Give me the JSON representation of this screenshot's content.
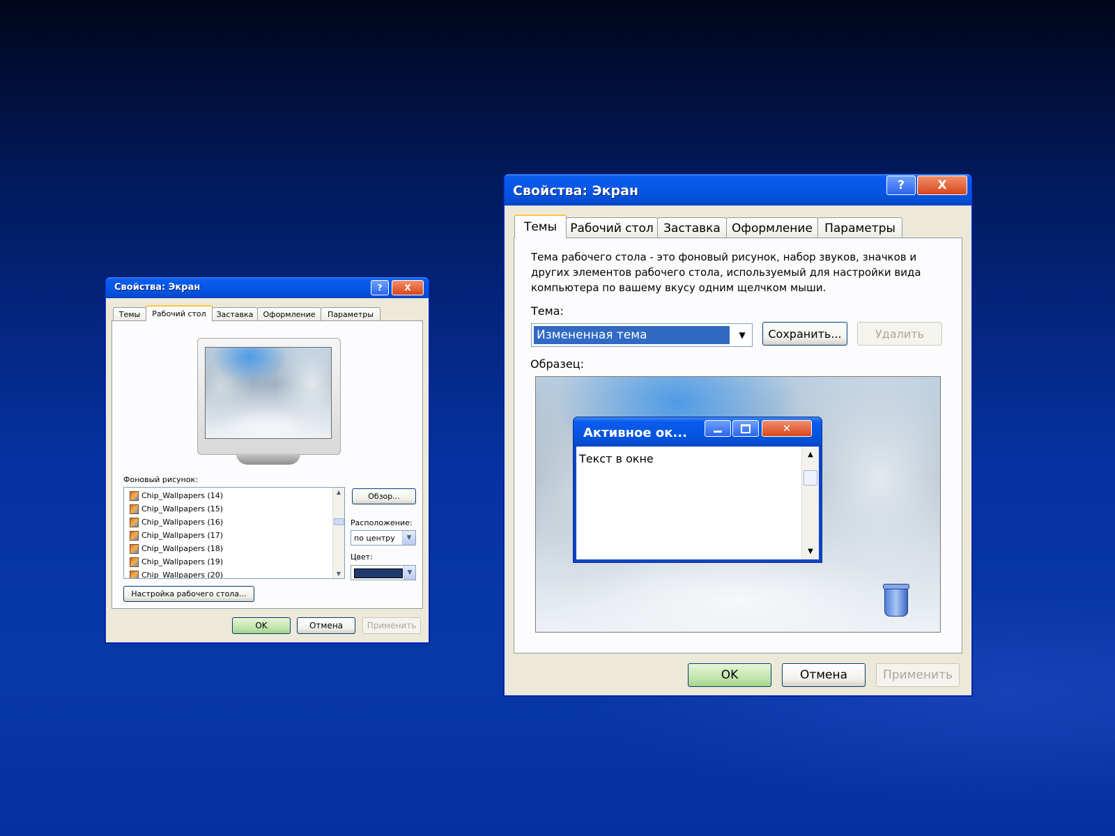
{
  "small_window": {
    "title": "Свойства: Экран",
    "help_label": "?",
    "close_label": "X",
    "tabs": [
      "Темы",
      "Рабочий стол",
      "Заставка",
      "Оформление",
      "Параметры"
    ],
    "active_tab": "Рабочий стол",
    "background_label": "Фоновый рисунок:",
    "wallpapers": [
      "Chip_Wallpapers (14)",
      "Chip_Wallpapers (15)",
      "Chip_Wallpapers (16)",
      "Chip_Wallpapers (17)",
      "Chip_Wallpapers (18)",
      "Chip_Wallpapers (19)",
      "Chip_Wallpapers (20)"
    ],
    "browse_label": "Обзор...",
    "position_label": "Расположение:",
    "position_value": "по центру",
    "color_label": "Цвет:",
    "color_value": "#1f3a6e",
    "customize_label": "Настройка рабочего стола...",
    "ok_label": "OK",
    "cancel_label": "Отмена",
    "apply_label": "Применить"
  },
  "large_window": {
    "title": "Свойства: Экран",
    "help_label": "?",
    "close_label": "X",
    "tabs": [
      "Темы",
      "Рабочий стол",
      "Заставка",
      "Оформление",
      "Параметры"
    ],
    "active_tab": "Темы",
    "description": "Тема рабочего стола - это фоновый рисунок, набор звуков, значков и других элементов рабочего стола, используемый для настройки вида компьютера по вашему вкусу одним щелчком мыши.",
    "theme_label": "Тема:",
    "theme_value": "Измененная тема",
    "save_label": "Сохранить...",
    "delete_label": "Удалить",
    "sample_label": "Образец:",
    "preview_window_title": "Активное ок...",
    "preview_window_text": "Текст в окне",
    "ok_label": "OK",
    "cancel_label": "Отмена",
    "apply_label": "Применить"
  },
  "icons": [
    "help-icon",
    "close-icon",
    "minimize-icon",
    "maximize-icon",
    "recycle-bin-icon",
    "dropdown-arrow-icon",
    "image-file-icon",
    "monitor-icon"
  ]
}
